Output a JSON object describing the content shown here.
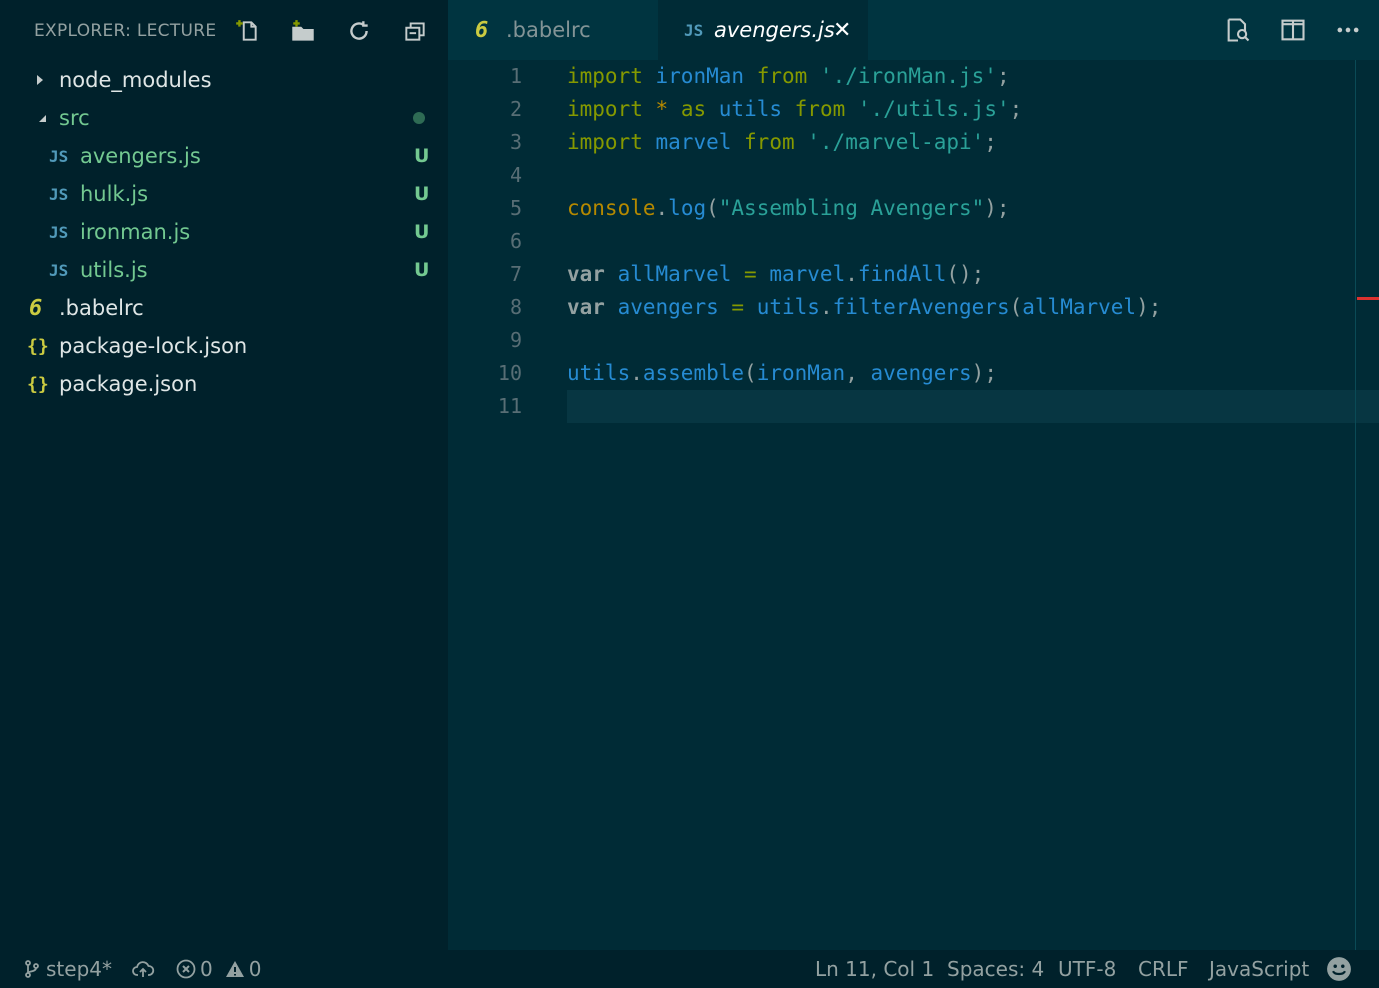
{
  "sidebar": {
    "title": "EXPLORER: LECTURE",
    "actions": [
      "new-file-icon",
      "new-folder-icon",
      "refresh-icon",
      "collapse-all-icon"
    ],
    "tree": [
      {
        "label": "node_modules",
        "type": "folder",
        "expanded": false
      },
      {
        "label": "src",
        "type": "folder",
        "expanded": true,
        "badge": "dot"
      },
      {
        "label": "avengers.js",
        "type": "js",
        "icon": "JS",
        "badge": "U"
      },
      {
        "label": "hulk.js",
        "type": "js",
        "icon": "JS",
        "badge": "U"
      },
      {
        "label": "ironman.js",
        "type": "js",
        "icon": "JS",
        "badge": "U"
      },
      {
        "label": "utils.js",
        "type": "js",
        "icon": "JS",
        "badge": "U"
      },
      {
        "label": ".babelrc",
        "type": "babel",
        "icon": "6"
      },
      {
        "label": "package-lock.json",
        "type": "json",
        "icon": "{}"
      },
      {
        "label": "package.json",
        "type": "json",
        "icon": "{}"
      }
    ]
  },
  "tabs": [
    {
      "label": ".babelrc",
      "icon": "6",
      "active": false
    },
    {
      "label": "avengers.js",
      "icon": "JS",
      "active": true,
      "close": "✕"
    }
  ],
  "editor_actions": [
    "open-preview-icon",
    "split-editor-icon",
    "more-actions-icon"
  ],
  "editor": {
    "current_line": 11,
    "lines": [
      "import ironMan from './ironMan.js';",
      "import * as utils from './utils.js';",
      "import marvel from './marvel-api';",
      "",
      "console.log(\"Assembling Avengers\");",
      "",
      "var allMarvel = marvel.findAll();",
      "var avengers = utils.filterAvengers(allMarvel);",
      "",
      "utils.assemble(ironMan, avengers);",
      ""
    ],
    "line_numbers": [
      "1",
      "2",
      "3",
      "4",
      "5",
      "6",
      "7",
      "8",
      "9",
      "10",
      "11"
    ]
  },
  "statusbar": {
    "branch": "step4*",
    "errors": "0",
    "warnings": "0",
    "position": "Ln 11, Col 1",
    "spaces": "Spaces: 4",
    "encoding": "UTF-8",
    "eol": "CRLF",
    "language": "JavaScript"
  },
  "colors": {
    "background": "#002b36",
    "sidebar": "#00212b",
    "keyword": "#859900",
    "identifier": "#268bd2",
    "string": "#2aa198",
    "git_untracked": "#73c991"
  }
}
